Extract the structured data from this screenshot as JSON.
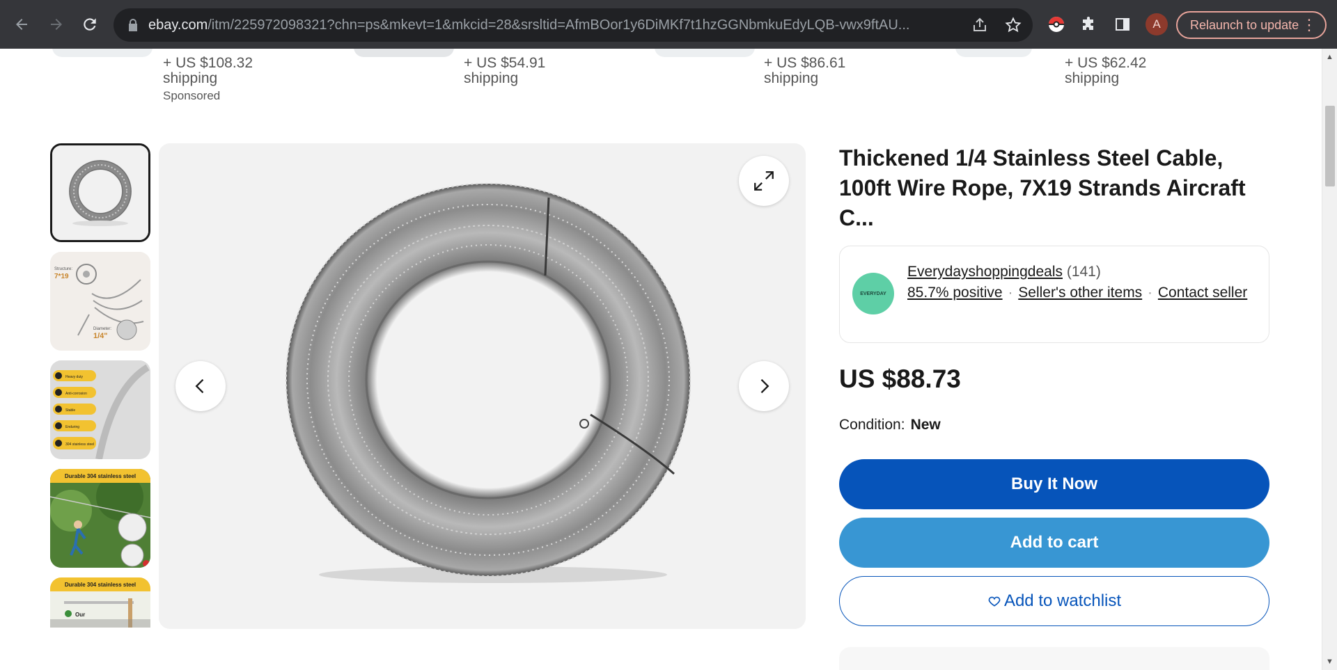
{
  "browser": {
    "url_domain": "ebay.com",
    "url_path": "/itm/225972098321?chn=ps&mkevt=1&mkcid=28&srsltid=AfmBOor1y6DiMKf7t1hzGGNbmkuEdyLQB-vwx9ftAU...",
    "avatar_letter": "A",
    "relaunch_label": "Relaunch to update",
    "menu_glyph": "⋮"
  },
  "strip": {
    "items": [
      {
        "price": "+ US $108.32",
        "shipping": "shipping",
        "sponsored": "Sponsored"
      },
      {
        "price": "+ US $54.91",
        "shipping": "shipping"
      },
      {
        "price": "+ US $86.61",
        "shipping": "shipping"
      },
      {
        "price": "+ US $62.42",
        "shipping": "shipping"
      }
    ]
  },
  "thumbnails": {
    "items": [
      {
        "name": "coil"
      },
      {
        "name": "structure",
        "label_a": "Structure:",
        "label_b": "7*19",
        "label_c": "Diameter:",
        "label_d": "1/4\""
      },
      {
        "name": "features",
        "rows": [
          "Heavy duty",
          "Anti-corrosion",
          "Stable",
          "Enduring",
          "304 stainless steel"
        ]
      },
      {
        "name": "zipline",
        "banner": "Durable 304 stainless steel"
      },
      {
        "name": "comparison",
        "banner": "Durable 304 stainless steel",
        "tag": "Our"
      }
    ]
  },
  "product": {
    "title": "Thickened 1/4 Stainless Steel Cable, 100ft Wire Rope, 7X19 Strands Aircraft C...",
    "price": "US $88.73",
    "condition_label": "Condition:",
    "condition_value": "New"
  },
  "seller": {
    "name": "Everydayshoppingdeals",
    "count": "(141)",
    "feedback": "85.7% positive",
    "other_items": "Seller's other items",
    "contact": "Contact seller",
    "logo_text": "EVERYDAY"
  },
  "actions": {
    "buy_now": "Buy It Now",
    "add_to_cart": "Add to cart",
    "watchlist": "Add to watchlist"
  },
  "colors": {
    "chrome_bg": "#35363a",
    "primary_blue": "#0654ba",
    "secondary_blue": "#3896d3",
    "seller_green": "#5ecfa6"
  }
}
